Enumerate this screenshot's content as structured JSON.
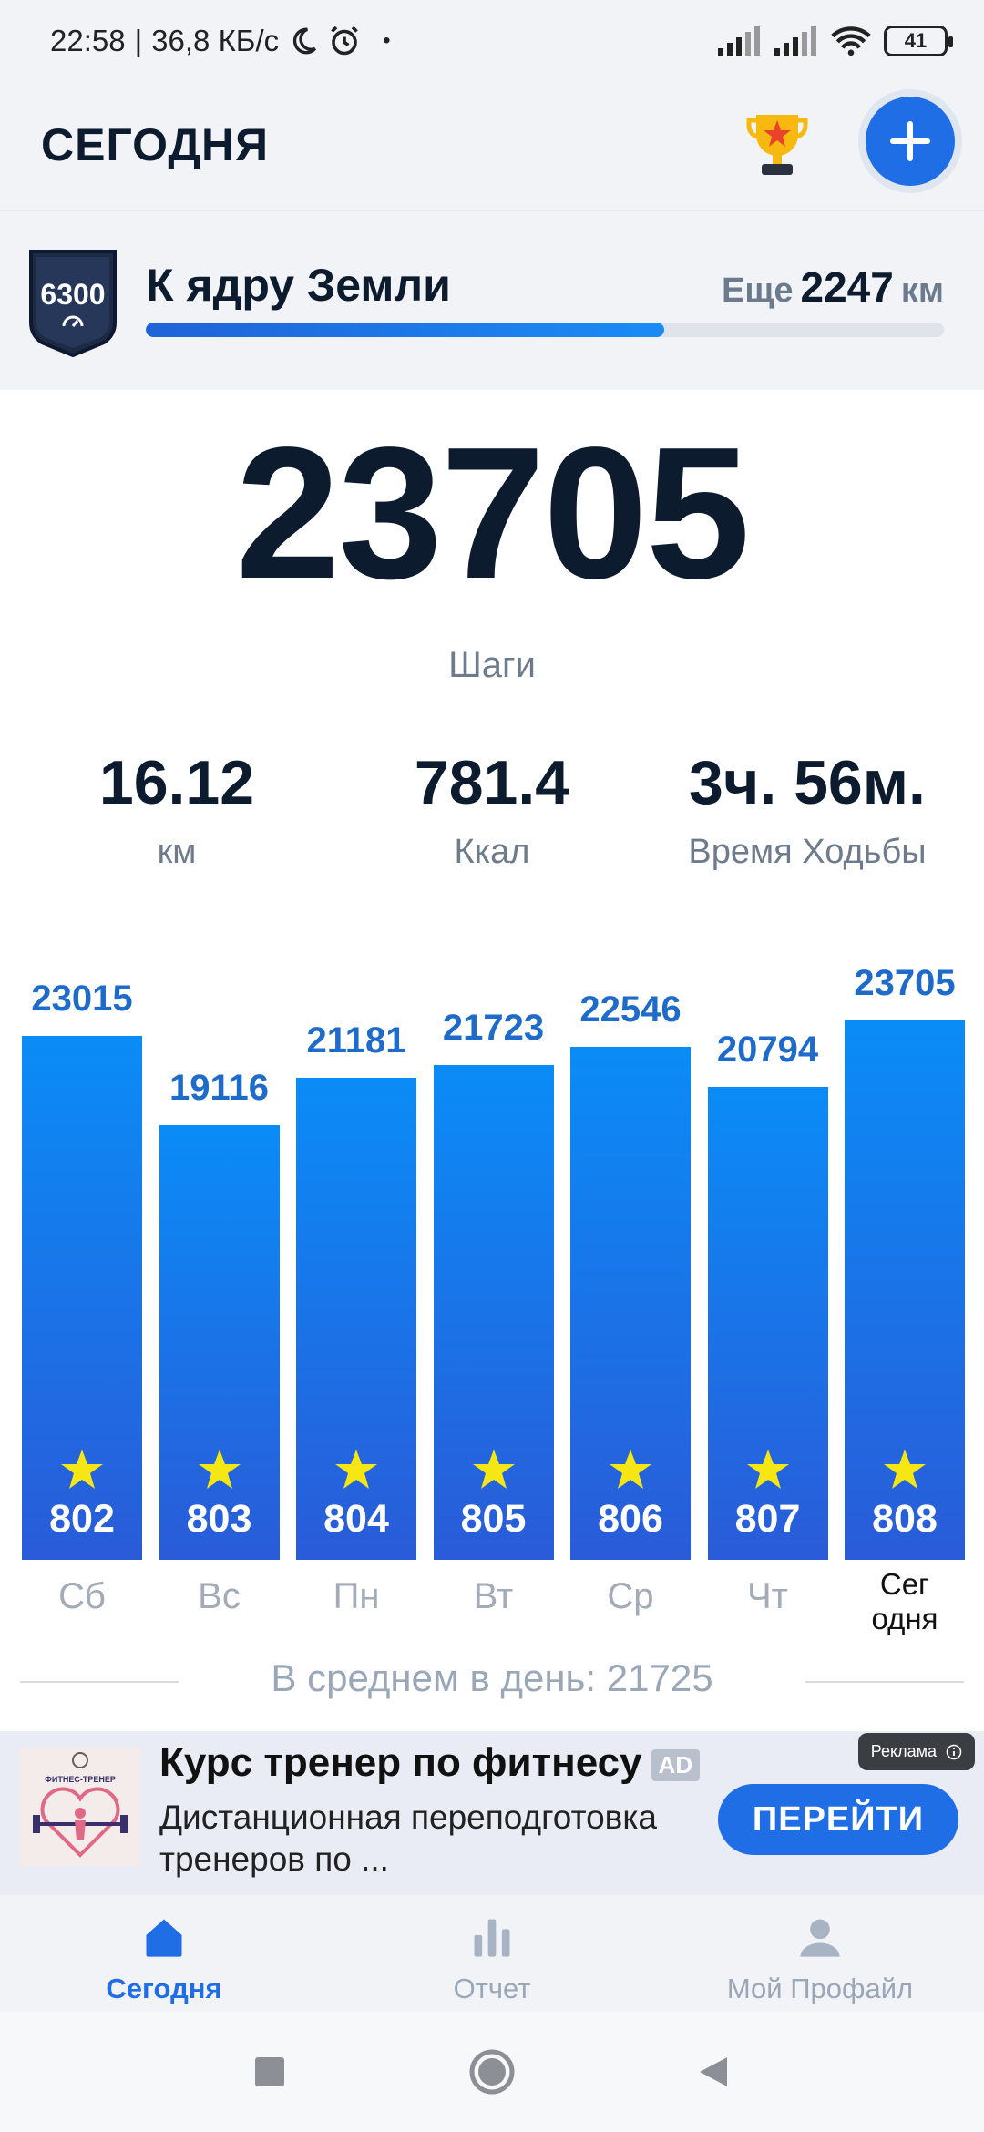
{
  "status_bar": {
    "time": "22:58",
    "network_speed": "36,8 КБ/с",
    "battery": "41",
    "icons": [
      "moon-icon",
      "alarm-icon",
      "signal-icon",
      "signal-icon",
      "wifi-icon",
      "battery-icon"
    ]
  },
  "header": {
    "title": "СЕГОДНЯ",
    "trophy_icon": "trophy-icon",
    "add_icon": "plus-icon"
  },
  "challenge": {
    "badge_number": "6300",
    "title": "К ядру Земли",
    "remaining_prefix": "Еще",
    "remaining_value": "2247",
    "remaining_unit": "км",
    "progress_fraction": 0.65
  },
  "steps": {
    "value": "23705",
    "label": "Шаги"
  },
  "stats": [
    {
      "value": "16.12",
      "label": "км"
    },
    {
      "value": "781.4",
      "label": "Ккал"
    },
    {
      "value": "3ч. 56м.",
      "label": "Время Ходьбы"
    }
  ],
  "chart_data": {
    "type": "bar",
    "categories": [
      "Сб",
      "Вс",
      "Пн",
      "Вт",
      "Ср",
      "Чт",
      "Сегодня"
    ],
    "category_display": [
      "Сб",
      "Вс",
      "Пн",
      "Вт",
      "Ср",
      "Чт",
      "Сег\nодня"
    ],
    "values": [
      23015,
      19116,
      21181,
      21723,
      22546,
      20794,
      23705
    ],
    "value_labels": [
      "23015",
      "19116",
      "21181",
      "21723",
      "22546",
      "20794",
      "23705"
    ],
    "star_counts": [
      "802",
      "803",
      "804",
      "805",
      "806",
      "807",
      "808"
    ],
    "ylim": [
      0,
      23705
    ]
  },
  "average": {
    "text": "В среднем в день: 21725"
  },
  "ad": {
    "title": "Курс тренер по фитнесу",
    "tag": "AD",
    "description": "Дистанционная переподготовка тренеров по ...",
    "label": "Реклама",
    "button": "ПЕРЕЙТИ",
    "image_title": "ФИТНЕС-ТРЕНЕР"
  },
  "bottom_nav": [
    {
      "label": "Сегодня",
      "icon": "home-icon",
      "active": true
    },
    {
      "label": "Отчет",
      "icon": "bar-chart-icon",
      "active": false
    },
    {
      "label": "Мой Профайл",
      "icon": "profile-icon",
      "active": false
    }
  ],
  "colors": {
    "accent": "#1f6ee6",
    "bar_top": "#0a8cf7",
    "bar_bottom": "#2a5bd8",
    "star": "#f5e614",
    "text_dark": "#0d1b2e"
  }
}
